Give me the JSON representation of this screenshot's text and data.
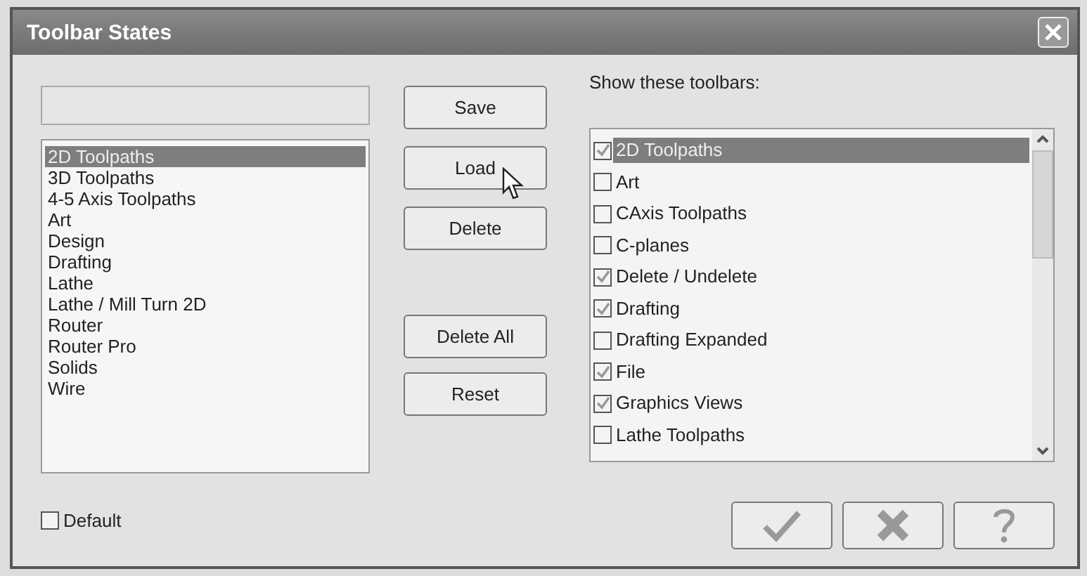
{
  "window": {
    "title": "Toolbar States"
  },
  "states": [
    {
      "label": "2D Toolpaths",
      "selected": true
    },
    {
      "label": "3D Toolpaths",
      "selected": false
    },
    {
      "label": "4-5 Axis Toolpaths",
      "selected": false
    },
    {
      "label": "Art",
      "selected": false
    },
    {
      "label": "Design",
      "selected": false
    },
    {
      "label": "Drafting",
      "selected": false
    },
    {
      "label": "Lathe",
      "selected": false
    },
    {
      "label": "Lathe / Mill Turn 2D",
      "selected": false
    },
    {
      "label": "Router",
      "selected": false
    },
    {
      "label": "Router Pro",
      "selected": false
    },
    {
      "label": "Solids",
      "selected": false
    },
    {
      "label": "Wire",
      "selected": false
    }
  ],
  "top_actions": [
    "Save",
    "Load",
    "Delete"
  ],
  "bottom_actions": [
    "Delete All",
    "Reset"
  ],
  "default_checkbox": {
    "label": "Default",
    "checked": false
  },
  "toolbars_label": "Show these toolbars:",
  "toolbars": [
    {
      "label": "2D Toolpaths",
      "checked": true,
      "selected": true
    },
    {
      "label": "Art",
      "checked": false,
      "selected": false
    },
    {
      "label": "CAxis Toolpaths",
      "checked": false,
      "selected": false
    },
    {
      "label": "C-planes",
      "checked": false,
      "selected": false
    },
    {
      "label": "Delete / Undelete",
      "checked": true,
      "selected": false
    },
    {
      "label": "Drafting",
      "checked": true,
      "selected": false
    },
    {
      "label": "Drafting Expanded",
      "checked": false,
      "selected": false
    },
    {
      "label": "File",
      "checked": true,
      "selected": false
    },
    {
      "label": "Graphics Views",
      "checked": true,
      "selected": false
    },
    {
      "label": "Lathe Toolpaths",
      "checked": false,
      "selected": false
    }
  ],
  "dialog_buttons": [
    {
      "kind": "ok"
    },
    {
      "kind": "cancel"
    },
    {
      "kind": "help"
    }
  ]
}
